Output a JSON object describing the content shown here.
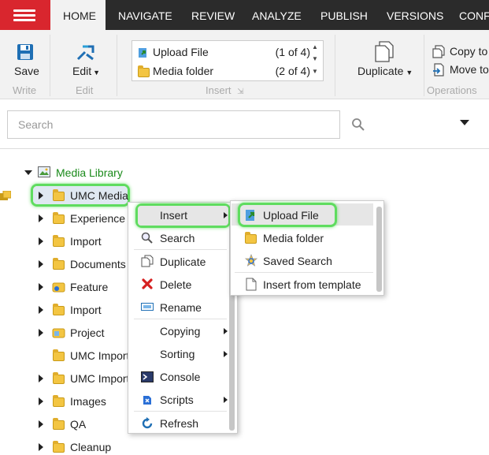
{
  "nav": {
    "tabs": [
      "HOME",
      "NAVIGATE",
      "REVIEW",
      "ANALYZE",
      "PUBLISH",
      "VERSIONS",
      "CONFI"
    ]
  },
  "ribbon": {
    "save_label": "Save",
    "write_group": "Write",
    "edit_label": "Edit",
    "edit_group": "Edit",
    "insert_options": [
      {
        "label": "Upload File",
        "count": "(1 of 4)"
      },
      {
        "label": "Media folder",
        "count": "(2 of 4)"
      }
    ],
    "insert_group": "Insert",
    "duplicate_label": "Duplicate",
    "copy_to_label": "Copy to",
    "move_to_label": "Move to",
    "operations_group": "Operations"
  },
  "search": {
    "placeholder": "Search"
  },
  "tree": {
    "root": "Media Library",
    "items": [
      "UMC Media",
      "Experience E",
      "Import",
      "Documents",
      "Feature",
      "Import",
      "Project",
      "UMC Import",
      "UMC Import",
      "Images",
      "QA",
      "Cleanup"
    ]
  },
  "context_menu": {
    "items": [
      "Insert",
      "Search",
      "Duplicate",
      "Delete",
      "Rename",
      "Copying",
      "Sorting",
      "Console",
      "Scripts",
      "Refresh"
    ]
  },
  "submenu": {
    "items": [
      "Upload File",
      "Media folder",
      "Saved Search",
      "Insert from template"
    ]
  },
  "colors": {
    "nav_bg": "#2b2b2b",
    "brand_red": "#d9262e",
    "tree_root_green": "#1a8a1a",
    "highlight_green": "#5fdc5f"
  }
}
